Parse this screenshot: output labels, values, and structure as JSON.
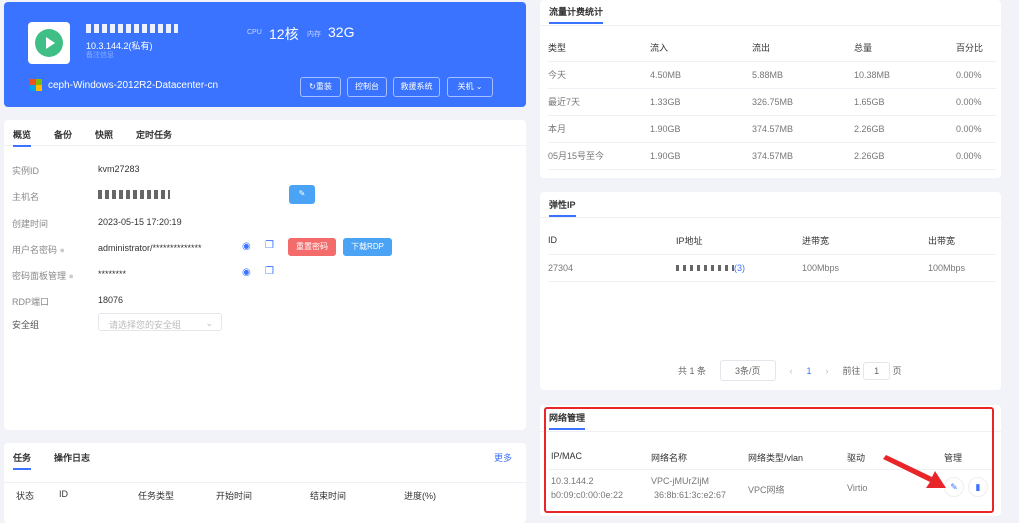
{
  "header": {
    "ip": "10.3.144.2(私有)",
    "remark": "备注信息",
    "cpu_label": "CPU",
    "cpu": "12核",
    "mem_label": "内存",
    "mem": "32G",
    "os": "ceph-Windows-2012R2-Datacenter-cn",
    "buttons": [
      "重装",
      "控制台",
      "救援系统",
      "关机"
    ]
  },
  "overview": {
    "tabs": [
      "概览",
      "备份",
      "快照",
      "定时任务"
    ],
    "rows": [
      {
        "label": "实例ID",
        "value": "kvm27283"
      },
      {
        "label": "主机名",
        "value": ""
      },
      {
        "label": "创建时间",
        "value": "2023-05-15 17:20:19"
      },
      {
        "label": "用户名密码",
        "value": "administrator/**************"
      },
      {
        "label": "密码面板管理",
        "value": "********"
      },
      {
        "label": "RDP端口",
        "value": "18076"
      },
      {
        "label": "安全组",
        "value": ""
      }
    ],
    "reset_pwd": "重置密码",
    "download_rdp": "下载RDP",
    "security_placeholder": "请选择您的安全组"
  },
  "tasks": {
    "tabs": [
      "任务",
      "操作日志"
    ],
    "more": "更多",
    "columns": [
      "状态",
      "ID",
      "任务类型",
      "开始时间",
      "结束时间",
      "进度(%)"
    ]
  },
  "traffic": {
    "title": "流量计费统计",
    "columns": [
      "类型",
      "流入",
      "流出",
      "总量",
      "百分比"
    ],
    "rows": [
      [
        "今天",
        "4.50MB",
        "5.88MB",
        "10.38MB",
        "0.00%"
      ],
      [
        "最近7天",
        "1.33GB",
        "326.75MB",
        "1.65GB",
        "0.00%"
      ],
      [
        "本月",
        "1.90GB",
        "374.57MB",
        "2.26GB",
        "0.00%"
      ],
      [
        "05月15号至今",
        "1.90GB",
        "374.57MB",
        "2.26GB",
        "0.00%"
      ]
    ]
  },
  "eip": {
    "title": "弹性IP",
    "columns": [
      "ID",
      "IP地址",
      "进带宽",
      "出带宽"
    ],
    "rows": [
      [
        "27304",
        "(3)",
        "100Mbps",
        "100Mbps"
      ]
    ],
    "pager": {
      "total": "共 1 条",
      "size": "3条/页",
      "page": "1",
      "goto": "前往",
      "goto_val": "1",
      "page_unit": "页"
    }
  },
  "network": {
    "title": "网络管理",
    "columns": [
      "IP/MAC",
      "网络名称",
      "网络类型/vlan",
      "驱动",
      "管理"
    ],
    "row": {
      "ip": "10.3.144.2",
      "mac": "b0:09:c0:00:0e:22",
      "name": "VPC-jMUrZIjM",
      "name_mac": "36:8b:61:3c:e2:67",
      "type": "VPC网络",
      "driver": "Virtio"
    }
  },
  "colors": {
    "primary": "#3a73ff",
    "danger": "#f36b6b",
    "running": "#3fbf86",
    "highlight": "#e8262a"
  }
}
